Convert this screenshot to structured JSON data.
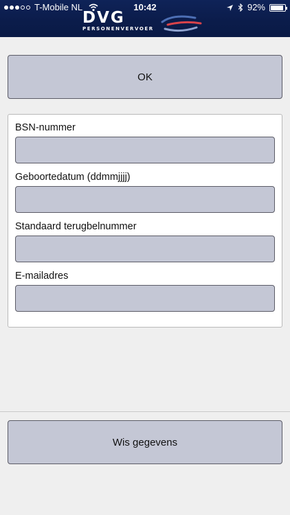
{
  "status_bar": {
    "carrier": "T-Mobile NL",
    "time": "10:42",
    "battery": "92%",
    "battery_level": 0.92
  },
  "header": {
    "logo_title": "DVG",
    "logo_subtitle": "PERSONENVERVOER"
  },
  "actions": {
    "ok_label": "OK",
    "clear_label": "Wis gegevens"
  },
  "form": {
    "fields": [
      {
        "label": "BSN-nummer",
        "value": ""
      },
      {
        "label": "Geboortedatum (ddmmjjjj)",
        "value": ""
      },
      {
        "label": "Standaard terugbelnummer",
        "value": ""
      },
      {
        "label": "E-mailadres",
        "value": ""
      }
    ]
  },
  "colors": {
    "header_bg": "#0b1c4b",
    "button_bg": "#c4c7d5",
    "page_bg": "#efefef",
    "logo_accent_blue": "#4d6fb5",
    "logo_accent_red": "#d9434a"
  }
}
